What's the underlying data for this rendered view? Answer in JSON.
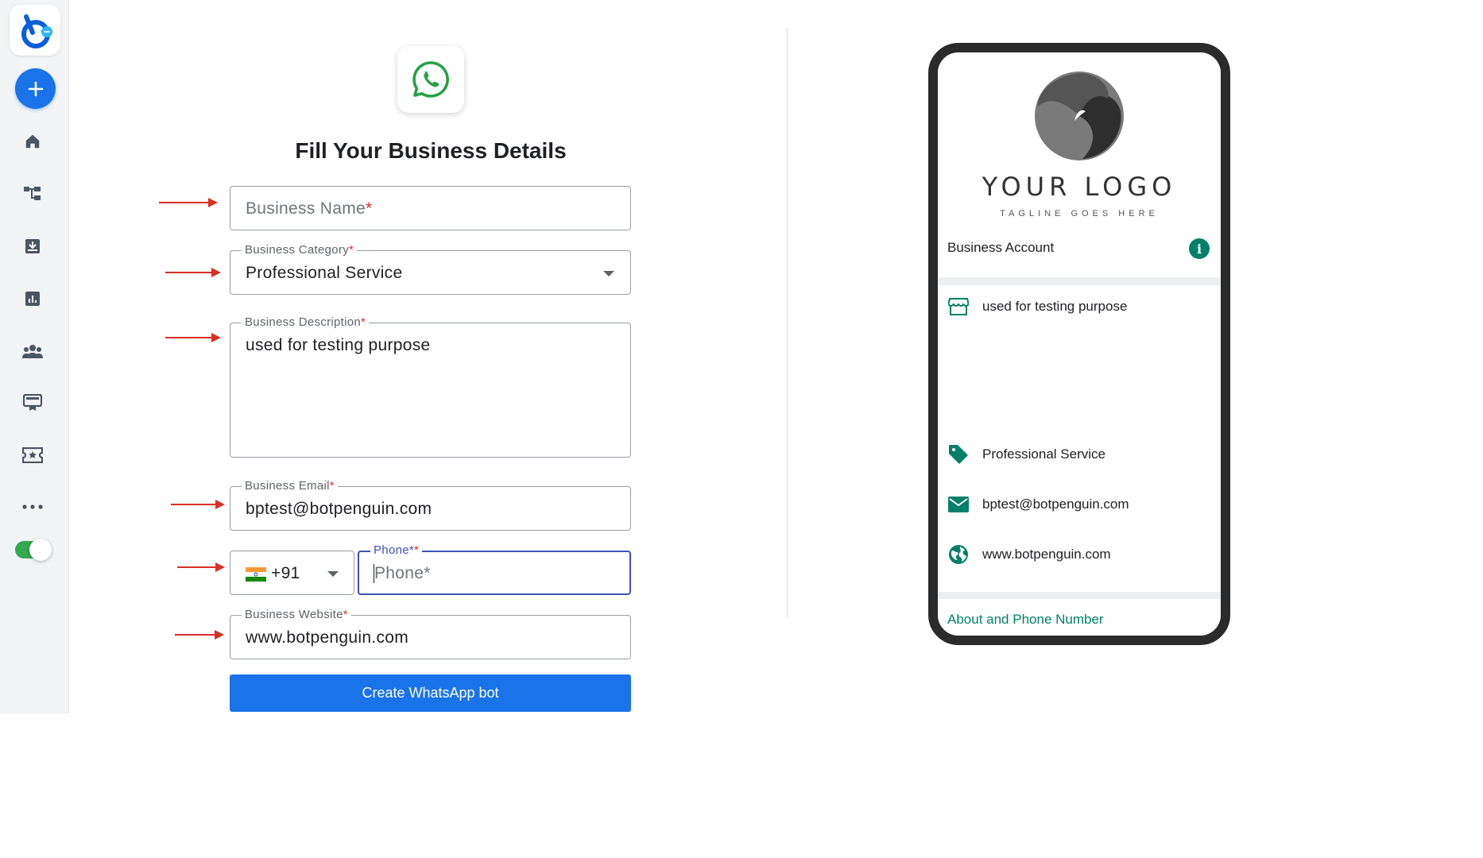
{
  "form": {
    "title": "Fill Your Business Details",
    "business_name": {
      "placeholder": "Business Name",
      "required_mark": "*"
    },
    "business_category": {
      "label": "Business Category",
      "required_mark": "*",
      "value": "Professional Service"
    },
    "business_description": {
      "label": "Business Description",
      "required_mark": "*",
      "value": "used for testing purpose"
    },
    "business_email": {
      "label": "Business Email",
      "required_mark": "*",
      "value": "bptest@botpenguin.com"
    },
    "phone": {
      "country_code": "+91",
      "label": "Phone*",
      "required_mark": "*",
      "placeholder": "Phone*"
    },
    "business_website": {
      "label": "Business Website",
      "required_mark": "*",
      "value": "www.botpenguin.com"
    },
    "submit_label": "Create WhatsApp bot"
  },
  "preview": {
    "logo_text": "YOUR LOGO",
    "tagline": "TAGLINE GOES HERE",
    "account_label": "Business Account",
    "description": "used for testing purpose",
    "category": "Professional Service",
    "email": "bptest@botpenguin.com",
    "website": "www.botpenguin.com",
    "footer_link": "About and Phone Number"
  },
  "sidebar": {
    "icons": [
      "home-icon",
      "flow-icon",
      "inbox-icon",
      "analytics-icon",
      "users-icon",
      "billing-icon",
      "ticket-icon",
      "more-icon"
    ],
    "toggle_on": true
  },
  "colors": {
    "primary": "#1a73e8",
    "whatsapp_green": "#008069",
    "arrow_red": "#d93025",
    "toggle_green": "#34a853"
  }
}
